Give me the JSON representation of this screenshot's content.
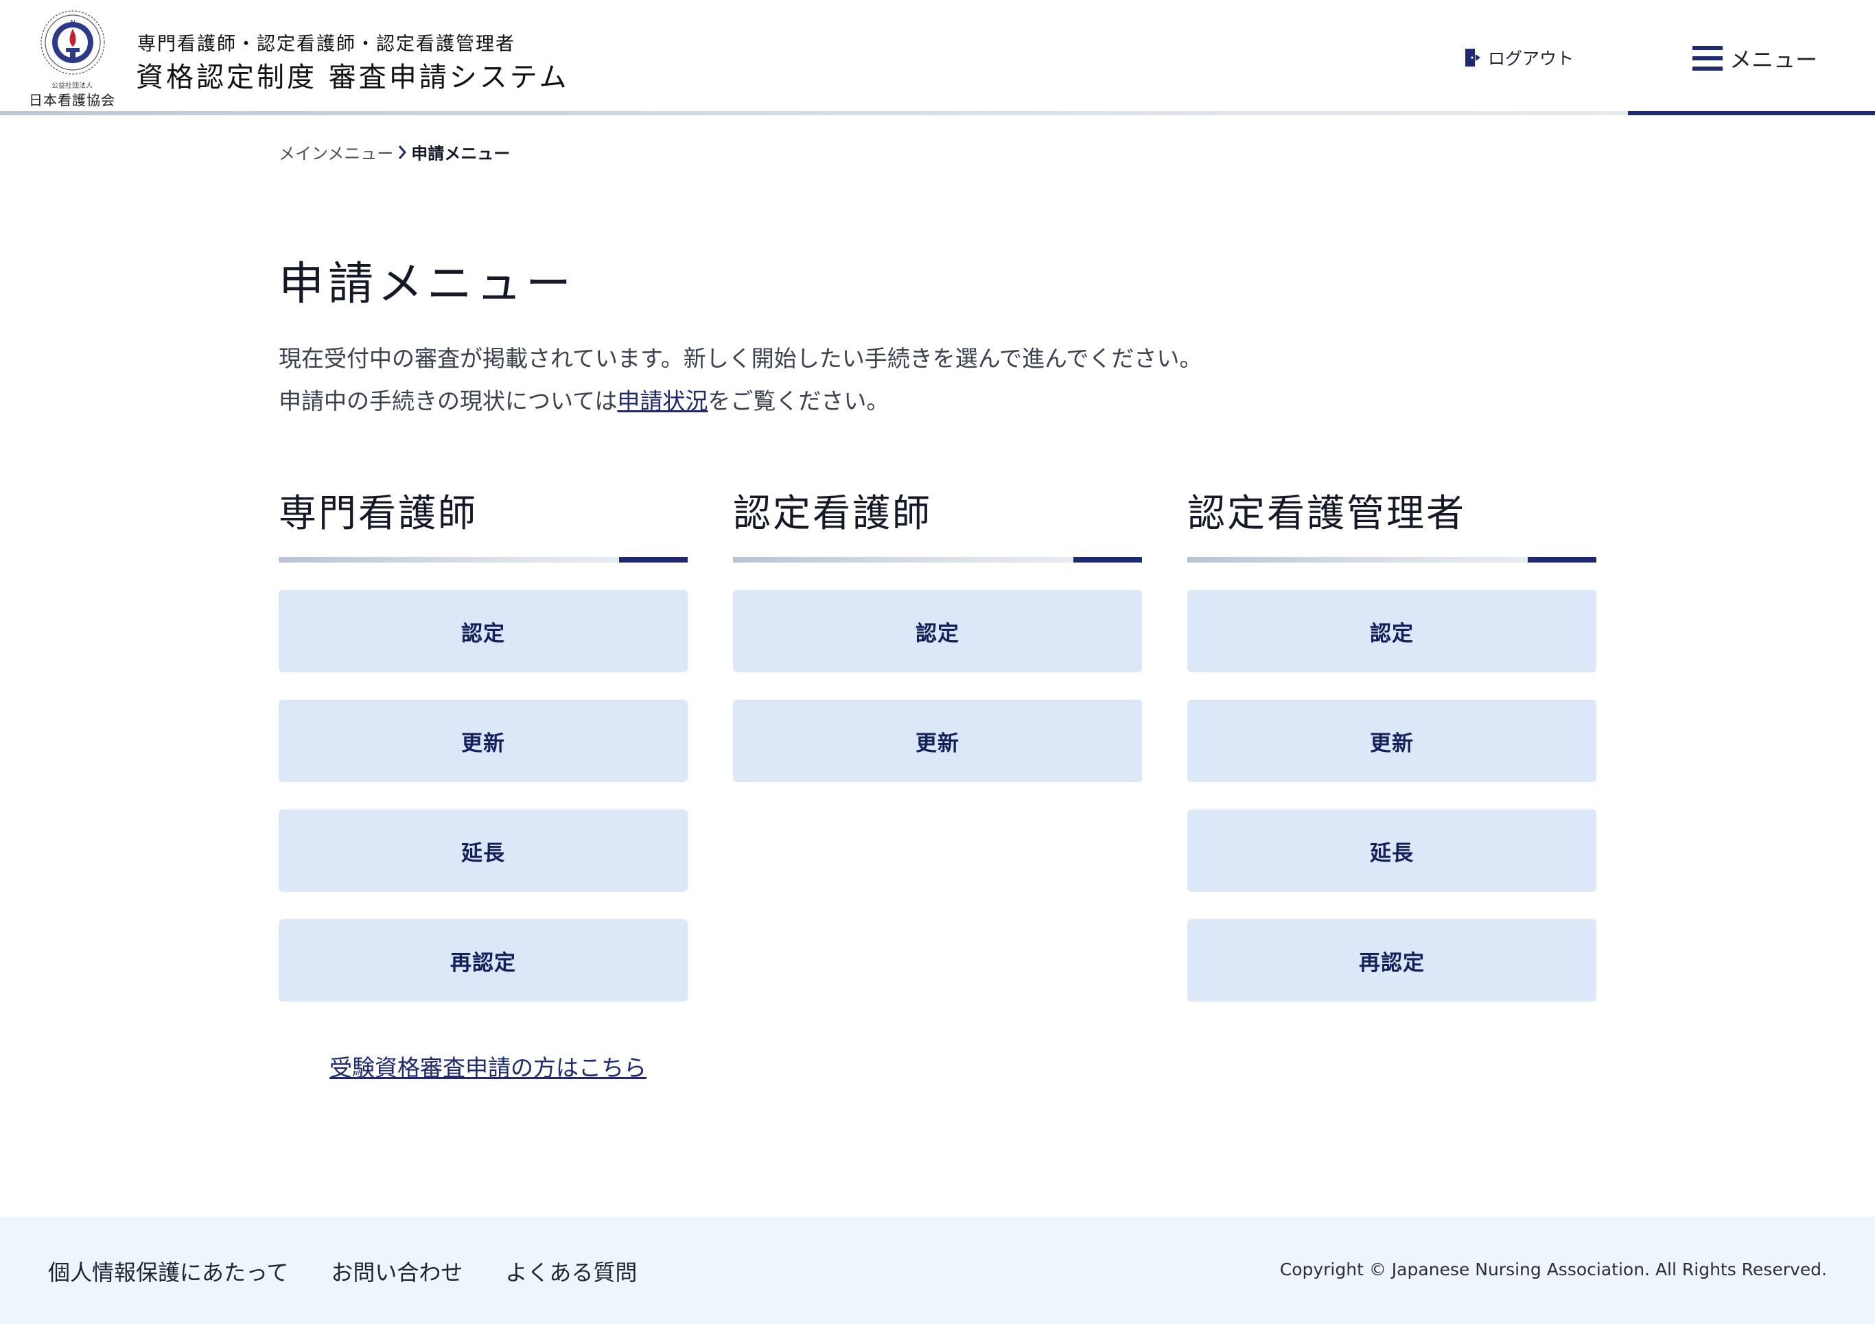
{
  "colors": {
    "accent": "#1d2a73",
    "button_bg": "#dce7f7",
    "footer_bg": "#eef5fd"
  },
  "header": {
    "logo": {
      "sub": "公益社団法人",
      "name": "日本看護協会",
      "icon": "jna-seal-icon"
    },
    "subtitle": "専門看護師・認定看護師・認定看護管理者",
    "title": "資格認定制度 審査申請システム",
    "logout_label": "ログアウト",
    "logout_icon": "logout-icon",
    "menu_label": "メニュー",
    "menu_icon": "hamburger-icon"
  },
  "breadcrumb": {
    "home": "メインメニュー",
    "current": "申請メニュー"
  },
  "main": {
    "title": "申請メニュー",
    "intro_line1": "現在受付中の審査が掲載されています。新しく開始したい手続きを選んで進んでください。",
    "intro_line2_before": "申請中の手続きの現状については",
    "intro_link": "申請状況",
    "intro_line2_after": "をご覧ください。",
    "columns": [
      {
        "title": "専門看護師",
        "buttons": [
          "認定",
          "更新",
          "延長",
          "再認定"
        ]
      },
      {
        "title": "認定看護師",
        "buttons": [
          "認定",
          "更新"
        ]
      },
      {
        "title": "認定看護管理者",
        "buttons": [
          "認定",
          "更新",
          "延長",
          "再認定"
        ]
      }
    ],
    "exam_link": "受験資格審査申請の方はこちら"
  },
  "footer": {
    "links": [
      "個人情報保護にあたって",
      "お問い合わせ",
      "よくある質問"
    ],
    "copyright": "Copyright © Japanese Nursing Association. All Rights Reserved."
  }
}
